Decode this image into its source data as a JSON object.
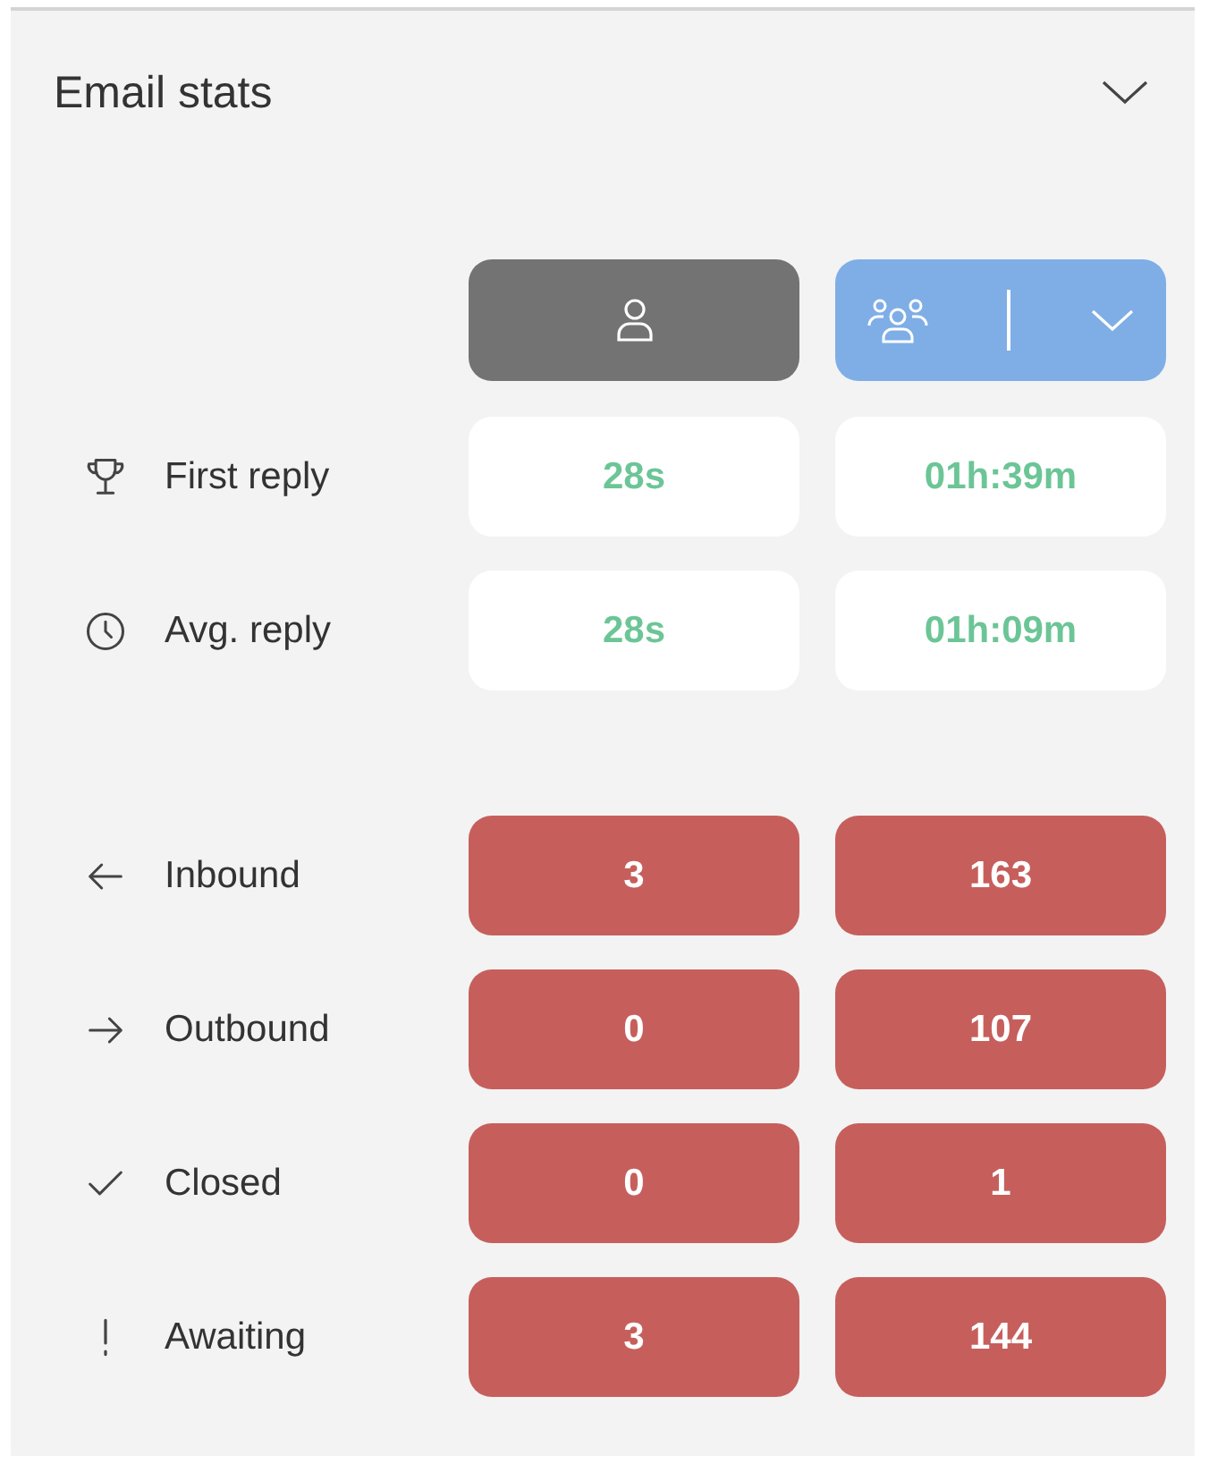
{
  "panel": {
    "title": "Email stats",
    "expanded": true
  },
  "scopes": [
    {
      "kind": "person",
      "selected": false
    },
    {
      "kind": "team",
      "selected": true
    }
  ],
  "sections": [
    {
      "kind": "time",
      "rows": [
        {
          "kind": "trophy",
          "label": "First reply",
          "values": [
            "28s",
            "01h:39m"
          ]
        },
        {
          "kind": "clock",
          "label": "Avg. reply",
          "values": [
            "28s",
            "01h:09m"
          ]
        }
      ]
    },
    {
      "kind": "alert",
      "rows": [
        {
          "kind": "inbound",
          "label": "Inbound",
          "values": [
            "3",
            "163"
          ]
        },
        {
          "kind": "outbound",
          "label": "Outbound",
          "values": [
            "0",
            "107"
          ]
        },
        {
          "kind": "closed",
          "label": "Closed",
          "values": [
            "0",
            "1"
          ]
        },
        {
          "kind": "awaiting",
          "label": "Awaiting",
          "values": [
            "3",
            "144"
          ]
        }
      ]
    }
  ]
}
